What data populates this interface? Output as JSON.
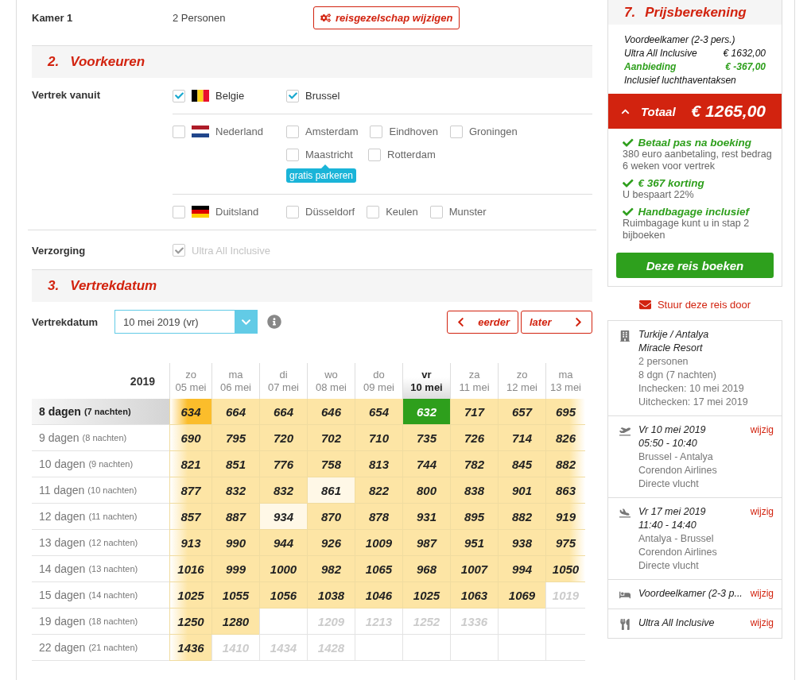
{
  "room": {
    "label": "Kamer 1",
    "value": "2 Personen",
    "button": "reisgezelschap wijzigen"
  },
  "preferences": {
    "number": "2.",
    "title": "Voorkeuren",
    "departure_label": "Vertrek vanuit",
    "countries": [
      {
        "name": "Belgie",
        "kind": "be",
        "checked": true,
        "airports": [
          {
            "name": "Brussel",
            "checked": true
          }
        ]
      },
      {
        "name": "Nederland",
        "kind": "nl",
        "checked": false,
        "airports": [
          {
            "name": "Amsterdam",
            "checked": false
          },
          {
            "name": "Eindhoven",
            "checked": false
          },
          {
            "name": "Groningen",
            "checked": false
          },
          {
            "name": "Maastricht",
            "checked": false,
            "badge": "gratis parkeren"
          },
          {
            "name": "Rotterdam",
            "checked": false
          }
        ]
      },
      {
        "name": "Duitsland",
        "kind": "de",
        "checked": false,
        "airports": [
          {
            "name": "Düsseldorf",
            "checked": false
          },
          {
            "name": "Keulen",
            "checked": false
          },
          {
            "name": "Munster",
            "checked": false
          }
        ]
      }
    ],
    "board_label": "Verzorging",
    "board": {
      "label": "Ultra All Inclusive",
      "checked": true,
      "disabled": true
    }
  },
  "departure": {
    "number": "3.",
    "title": "Vertrekdatum",
    "field_label": "Vertrekdatum",
    "value": "10 mei 2019 (vr)",
    "earlier": "eerder",
    "later": "later"
  },
  "calendar": {
    "year": "2019",
    "columns": [
      {
        "day": "zo",
        "date": "05 mei",
        "selected": false
      },
      {
        "day": "ma",
        "date": "06 mei",
        "selected": false
      },
      {
        "day": "di",
        "date": "07 mei",
        "selected": false
      },
      {
        "day": "wo",
        "date": "08 mei",
        "selected": false
      },
      {
        "day": "do",
        "date": "09 mei",
        "selected": false
      },
      {
        "day": "vr",
        "date": "10 mei",
        "selected": true
      },
      {
        "day": "za",
        "date": "11 mei",
        "selected": false
      },
      {
        "day": "zo",
        "date": "12 mei",
        "selected": false
      },
      {
        "day": "ma",
        "date": "13 mei",
        "selected": false
      }
    ],
    "rows": [
      {
        "days": "8 dagen",
        "nights": "(7 nachten)",
        "selected": true,
        "cells": [
          {
            "price": "634",
            "kind": "best"
          },
          {
            "price": "664",
            "kind": "price"
          },
          {
            "price": "664",
            "kind": "price"
          },
          {
            "price": "646",
            "kind": "price"
          },
          {
            "price": "654",
            "kind": "price"
          },
          {
            "price": "632",
            "kind": "selected"
          },
          {
            "price": "717",
            "kind": "price"
          },
          {
            "price": "657",
            "kind": "price"
          },
          {
            "price": "695",
            "kind": "price"
          }
        ]
      },
      {
        "days": "9 dagen",
        "nights": "(8 nachten)",
        "selected": false,
        "cells": [
          {
            "price": "690",
            "kind": "price"
          },
          {
            "price": "795",
            "kind": "price"
          },
          {
            "price": "720",
            "kind": "price"
          },
          {
            "price": "702",
            "kind": "price"
          },
          {
            "price": "710",
            "kind": "price"
          },
          {
            "price": "735",
            "kind": "price"
          },
          {
            "price": "726",
            "kind": "price"
          },
          {
            "price": "714",
            "kind": "price"
          },
          {
            "price": "826",
            "kind": "price"
          }
        ]
      },
      {
        "days": "10 dagen",
        "nights": "(9 nachten)",
        "selected": false,
        "cells": [
          {
            "price": "821",
            "kind": "price"
          },
          {
            "price": "851",
            "kind": "price"
          },
          {
            "price": "776",
            "kind": "price"
          },
          {
            "price": "758",
            "kind": "price"
          },
          {
            "price": "813",
            "kind": "price"
          },
          {
            "price": "744",
            "kind": "price"
          },
          {
            "price": "782",
            "kind": "price"
          },
          {
            "price": "845",
            "kind": "price"
          },
          {
            "price": "882",
            "kind": "price"
          }
        ]
      },
      {
        "days": "11 dagen",
        "nights": "(10 nachten)",
        "selected": false,
        "cells": [
          {
            "price": "877",
            "kind": "price"
          },
          {
            "price": "832",
            "kind": "price"
          },
          {
            "price": "832",
            "kind": "price"
          },
          {
            "price": "861",
            "kind": "low"
          },
          {
            "price": "822",
            "kind": "price"
          },
          {
            "price": "800",
            "kind": "price"
          },
          {
            "price": "838",
            "kind": "price"
          },
          {
            "price": "901",
            "kind": "price"
          },
          {
            "price": "863",
            "kind": "price"
          }
        ]
      },
      {
        "days": "12 dagen",
        "nights": "(11 nachten)",
        "selected": false,
        "cells": [
          {
            "price": "857",
            "kind": "price"
          },
          {
            "price": "887",
            "kind": "price"
          },
          {
            "price": "934",
            "kind": "low"
          },
          {
            "price": "870",
            "kind": "price"
          },
          {
            "price": "878",
            "kind": "price"
          },
          {
            "price": "931",
            "kind": "price"
          },
          {
            "price": "895",
            "kind": "price"
          },
          {
            "price": "882",
            "kind": "price"
          },
          {
            "price": "919",
            "kind": "price"
          }
        ]
      },
      {
        "days": "13 dagen",
        "nights": "(12 nachten)",
        "selected": false,
        "cells": [
          {
            "price": "913",
            "kind": "price"
          },
          {
            "price": "990",
            "kind": "price"
          },
          {
            "price": "944",
            "kind": "price"
          },
          {
            "price": "926",
            "kind": "price"
          },
          {
            "price": "1009",
            "kind": "price"
          },
          {
            "price": "987",
            "kind": "price"
          },
          {
            "price": "951",
            "kind": "price"
          },
          {
            "price": "938",
            "kind": "price"
          },
          {
            "price": "975",
            "kind": "price"
          }
        ]
      },
      {
        "days": "14 dagen",
        "nights": "(13 nachten)",
        "selected": false,
        "cells": [
          {
            "price": "1016",
            "kind": "price"
          },
          {
            "price": "999",
            "kind": "price"
          },
          {
            "price": "1000",
            "kind": "price"
          },
          {
            "price": "982",
            "kind": "price"
          },
          {
            "price": "1065",
            "kind": "price"
          },
          {
            "price": "968",
            "kind": "price"
          },
          {
            "price": "1007",
            "kind": "price"
          },
          {
            "price": "994",
            "kind": "price"
          },
          {
            "price": "1050",
            "kind": "price"
          }
        ]
      },
      {
        "days": "15 dagen",
        "nights": "(14 nachten)",
        "selected": false,
        "cells": [
          {
            "price": "1025",
            "kind": "price"
          },
          {
            "price": "1055",
            "kind": "price"
          },
          {
            "price": "1056",
            "kind": "price"
          },
          {
            "price": "1038",
            "kind": "price"
          },
          {
            "price": "1046",
            "kind": "price"
          },
          {
            "price": "1025",
            "kind": "price"
          },
          {
            "price": "1063",
            "kind": "price"
          },
          {
            "price": "1069",
            "kind": "price"
          },
          {
            "price": "1019",
            "kind": "na"
          }
        ]
      },
      {
        "days": "19 dagen",
        "nights": "(18 nachten)",
        "selected": false,
        "cells": [
          {
            "price": "1250",
            "kind": "price"
          },
          {
            "price": "1280",
            "kind": "price"
          },
          {
            "kind": "empty"
          },
          {
            "price": "1209",
            "kind": "na"
          },
          {
            "price": "1213",
            "kind": "na"
          },
          {
            "price": "1252",
            "kind": "na"
          },
          {
            "price": "1336",
            "kind": "na"
          },
          {
            "kind": "empty"
          },
          {
            "kind": "empty"
          }
        ]
      },
      {
        "days": "22 dagen",
        "nights": "(21 nachten)",
        "selected": false,
        "cells": [
          {
            "price": "1436",
            "kind": "price"
          },
          {
            "price": "1410",
            "kind": "na"
          },
          {
            "price": "1434",
            "kind": "na"
          },
          {
            "price": "1428",
            "kind": "na"
          },
          {
            "kind": "empty"
          },
          {
            "kind": "empty"
          },
          {
            "kind": "empty"
          },
          {
            "kind": "empty"
          },
          {
            "kind": "empty"
          }
        ]
      }
    ]
  },
  "price": {
    "number": "7.",
    "title": "Prijsberekening",
    "lines": [
      {
        "label": "Voordeelkamer (2-3 pers.)",
        "kind": "normal"
      },
      {
        "label": "Ultra All Inclusive",
        "amount": "€ 1632,00",
        "kind": "normal"
      },
      {
        "label": "Aanbieding",
        "amount": "€ -367,00",
        "kind": "discount"
      },
      {
        "label": "Inclusief luchthaventaksen",
        "kind": "normal"
      }
    ],
    "total": {
      "label": "Totaal",
      "amount": "€ 1265,00",
      "expanded": true
    },
    "benefits": [
      {
        "title": "Betaal pas na boeking",
        "text": "380 euro aanbetaling, rest bedrag 6 weken voor vertrek"
      },
      {
        "title": "€ 367 korting",
        "text": "U bespaart 22%"
      },
      {
        "title": "Handbagage inclusief",
        "text": "Ruimbagage kunt u in stap 2 bijboeken"
      }
    ],
    "button": "Deze reis boeken"
  },
  "share": "Stuur deze reis door",
  "summary": [
    {
      "kind": "hotel",
      "title": [
        "Turkije / Antalya",
        "Miracle Resort"
      ],
      "details": [
        "2 personen",
        "8 dgn (7 nachten)",
        "Inchecken: 10 mei 2019",
        "Uitchecken: 17 mei 2019"
      ]
    },
    {
      "kind": "outbound",
      "title": [
        "Vr 10 mei 2019",
        "05:50 - 10:40"
      ],
      "details": [
        "Brussel - Antalya",
        "Corendon Airlines",
        "Directe vlucht"
      ],
      "action": "wijzig"
    },
    {
      "kind": "return",
      "title": [
        "Vr 17 mei 2019",
        "11:40 - 14:40"
      ],
      "details": [
        "Antalya - Brussel",
        "Corendon Airlines",
        "Directe vlucht"
      ],
      "action": "wijzig"
    },
    {
      "kind": "room",
      "title": [
        "Voordeelkamer (2-3 p..."
      ],
      "action": "wijzig"
    },
    {
      "kind": "board",
      "title": [
        "Ultra All Inclusive"
      ],
      "action": "wijzig"
    }
  ]
}
